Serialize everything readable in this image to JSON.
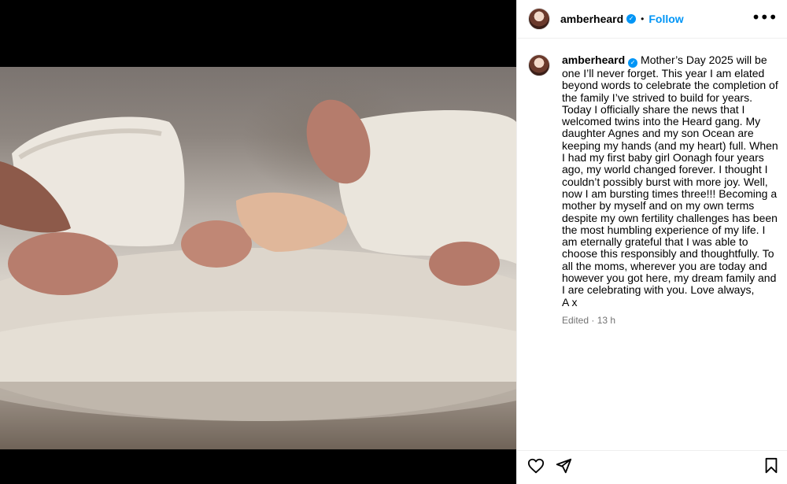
{
  "post": {
    "username": "amberheard",
    "verified_label": "✓",
    "dot": "•",
    "follow_label": "Follow",
    "more_label": "•••",
    "caption": "Mother’s Day 2025 will be one I’ll never forget. This year I am elated beyond words to celebrate the completion of the family I’ve strived to build for years. Today I officially share the news that I welcomed twins into the Heard gang. My daughter Agnes and my son Ocean are keeping my hands (and my heart) full. When I had my first baby girl Oonagh four years ago, my world changed forever. I thought I couldn’t possibly burst with more joy. Well, now I am bursting times three!!! Becoming a mother by myself and on my own terms despite my own fertility challenges has been the most humbling experience of my life. I am eternally grateful that I was able to choose this responsibly and thoughtfully. To all the moms, wherever you are today and however you got here, my dream family and I are celebrating with you. Love always,\nA x",
    "edited": "Edited · 13 h"
  },
  "icons": {
    "like": "heart-icon",
    "share": "send-icon",
    "save": "bookmark-icon",
    "more": "more-options-icon",
    "verified": "verified-badge-icon"
  },
  "colors": {
    "accent": "#0095f6",
    "muted": "#737373",
    "divider": "#efefef"
  }
}
